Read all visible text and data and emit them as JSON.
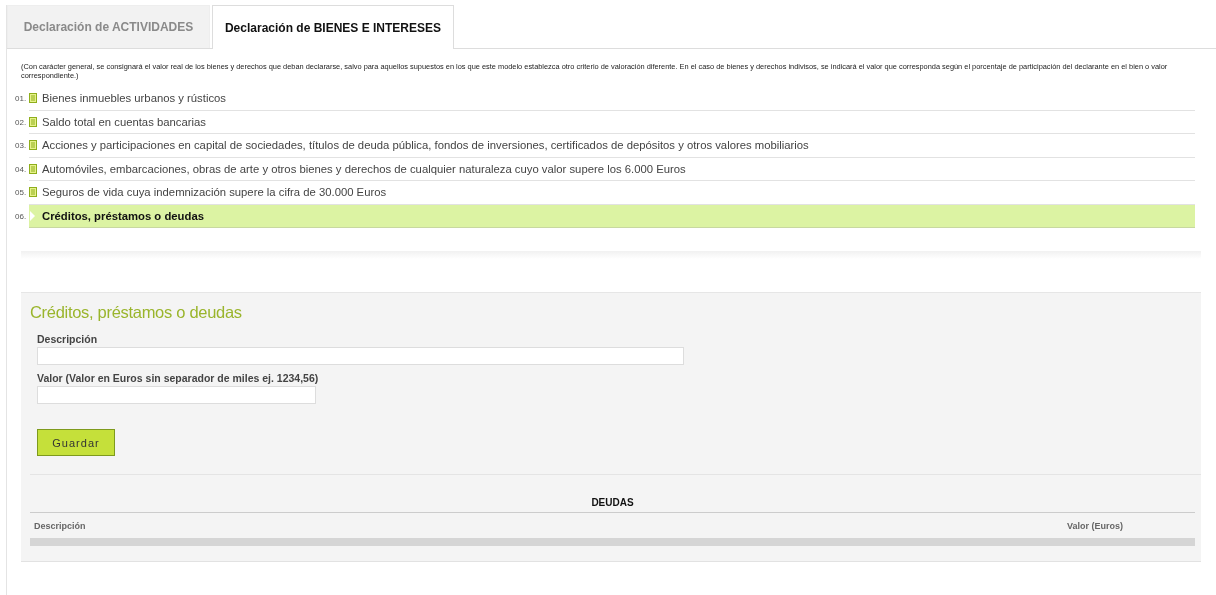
{
  "tabs": [
    {
      "label": "Declaración de ACTIVIDADES",
      "selected": false
    },
    {
      "label": "Declaración de BIENES E INTERESES",
      "selected": true
    }
  ],
  "note": "(Con carácter general, se consignará el valor real de los bienes y derechos que deban declararse, salvo para aquellos supuestos en los que este modelo establezca otro criterio de valoración diferente. En el caso de bienes y derechos indivisos, se indicará el valor que corresponda según el porcentaje de participación del declarante en el bien o valor correspondiente.)",
  "sections": [
    {
      "number": "01.",
      "label": "Bienes inmuebles urbanos y rústicos",
      "selected": false
    },
    {
      "number": "02.",
      "label": "Saldo total en cuentas bancarias",
      "selected": false
    },
    {
      "number": "03.",
      "label": "Acciones y participaciones en capital de sociedades, títulos de deuda pública, fondos de inversiones, certificados de depósitos y otros valores mobiliarios",
      "selected": false
    },
    {
      "number": "04.",
      "label": "Automóviles, embarcaciones, obras de arte y otros bienes y derechos de cualquier naturaleza cuyo valor supere los 6.000 Euros",
      "selected": false
    },
    {
      "number": "05.",
      "label": "Seguros de vida cuya indemnización supere la cifra de 30.000 Euros",
      "selected": false
    },
    {
      "number": "06.",
      "label": "Créditos, préstamos o deudas",
      "selected": true
    }
  ],
  "form": {
    "title": "Créditos, préstamos o deudas",
    "fields": [
      {
        "label": "Descripción",
        "kind": "wide"
      },
      {
        "label": "Valor (Valor en Euros sin separador de miles ej. 1234,56)",
        "kind": "narrow"
      }
    ],
    "button": "Guardar"
  },
  "table": {
    "title": "DEUDAS",
    "columns": [
      "Descripción",
      "Valor (Euros)"
    ]
  }
}
